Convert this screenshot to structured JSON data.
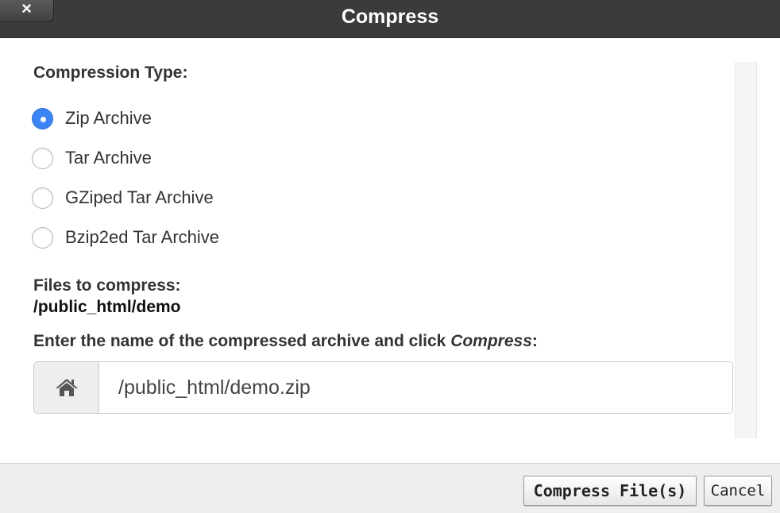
{
  "dialog": {
    "title": "Compress",
    "close_label": "×"
  },
  "compression": {
    "label": "Compression Type:",
    "options": [
      {
        "label": "Zip Archive",
        "checked": true
      },
      {
        "label": "Tar Archive",
        "checked": false
      },
      {
        "label": "GZiped Tar Archive",
        "checked": false
      },
      {
        "label": "Bzip2ed Tar Archive",
        "checked": false
      }
    ]
  },
  "files": {
    "label": "Files to compress:",
    "path": "/public_html/demo"
  },
  "archive": {
    "prompt_prefix": "Enter the name of the compressed archive and click ",
    "prompt_emphasis": "Compress",
    "prompt_suffix": ":",
    "value": "/public_html/demo.zip",
    "addon_icon": "home-icon"
  },
  "buttons": {
    "compress": "Compress File(s)",
    "cancel": "Cancel"
  },
  "colors": {
    "titlebar": "#3b3b3b",
    "radio_checked": "#3d84f4",
    "footer": "#eeeeee"
  }
}
